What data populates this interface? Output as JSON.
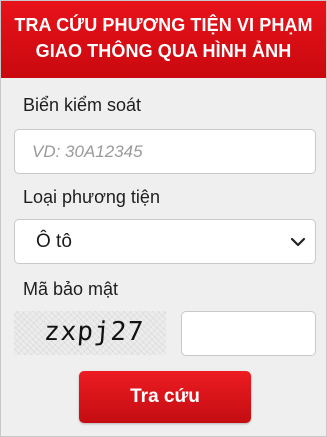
{
  "header": {
    "title_line1": "TRA CỨU PHƯƠNG TIỆN VI PHẠM",
    "title_line2": "GIAO THÔNG QUA HÌNH ẢNH"
  },
  "plate": {
    "label": "Biển kiểm soát",
    "placeholder": "VD: 30A12345",
    "value": ""
  },
  "vehicle_type": {
    "label": "Loại phương tiện",
    "selected": "Ô tô",
    "icon": "chevron-down-icon"
  },
  "captcha": {
    "label": "Mã bảo mật",
    "image_text": "zxpj27",
    "input_value": ""
  },
  "submit": {
    "label": "Tra cứu"
  },
  "colors": {
    "header_red": "#e0101a",
    "button_red": "#d8141a",
    "panel_bg": "#efefef"
  }
}
